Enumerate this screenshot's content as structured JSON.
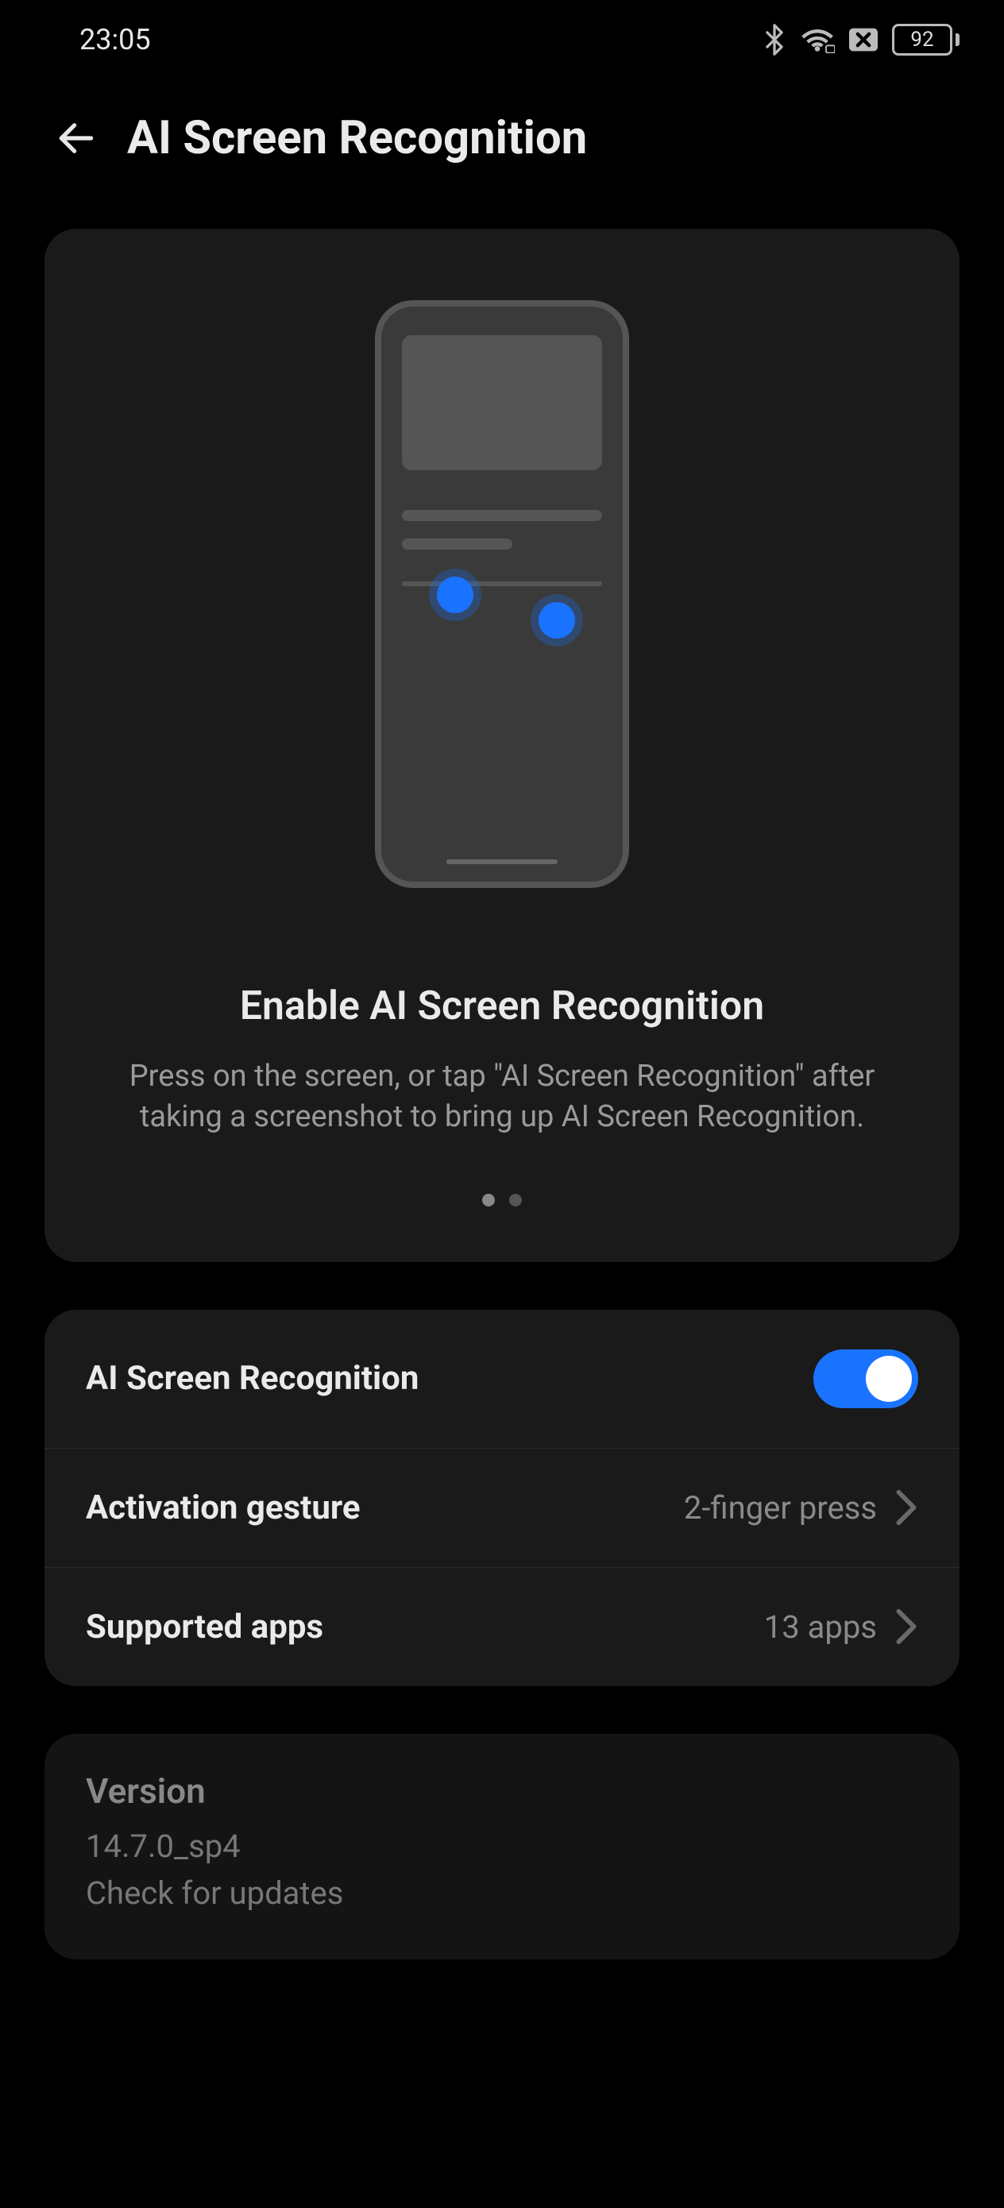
{
  "status": {
    "time": "23:05",
    "battery": "92"
  },
  "header": {
    "title": "AI Screen Recognition"
  },
  "hero": {
    "title": "Enable AI Screen Recognition",
    "desc": "Press on the screen, or tap \"AI Screen Recognition\" after taking a screenshot to bring up AI Screen Recognition."
  },
  "settings": {
    "toggle_label": "AI Screen Recognition",
    "activation_label": "Activation gesture",
    "activation_value": "2-finger press",
    "supported_label": "Supported apps",
    "supported_value": "13 apps"
  },
  "version": {
    "title": "Version",
    "number": "14.7.0_sp4",
    "check": "Check for updates"
  }
}
